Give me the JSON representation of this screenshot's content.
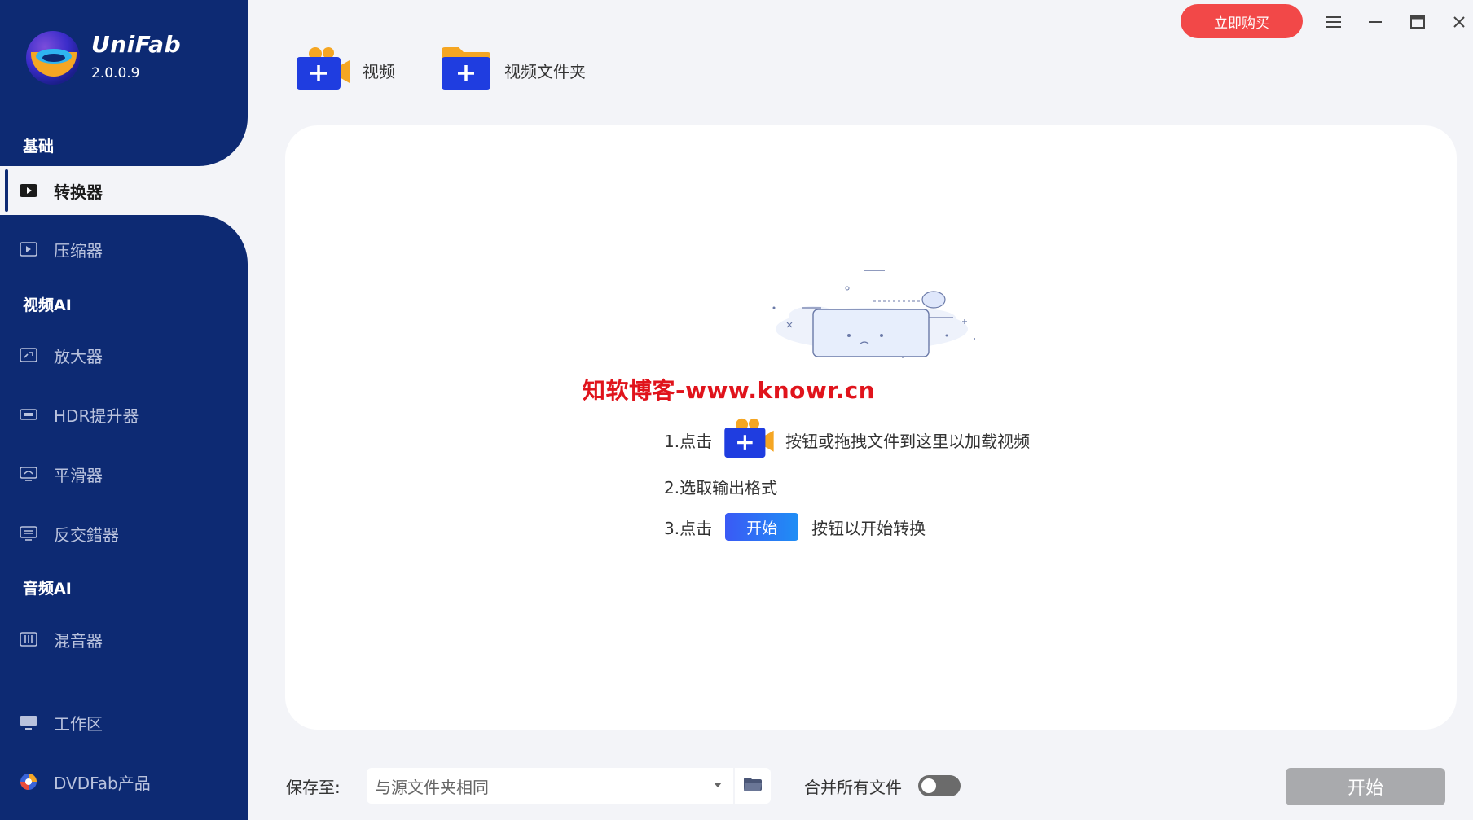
{
  "app": {
    "brand": "UniFab",
    "version": "2.0.0.9",
    "buy_label": "立即购买"
  },
  "sidebar": {
    "sections": {
      "basic": "基础",
      "video_ai": "视频AI",
      "audio_ai": "音频AI"
    },
    "items": [
      {
        "label": "转换器",
        "icon": "play-icon",
        "active": true
      },
      {
        "label": "压缩器",
        "icon": "compress-icon"
      },
      {
        "label": "放大器",
        "icon": "upscale-icon"
      },
      {
        "label": "HDR提升器",
        "icon": "hdr-icon"
      },
      {
        "label": "平滑器",
        "icon": "smoother-icon"
      },
      {
        "label": "反交錯器",
        "icon": "deinterlace-icon"
      },
      {
        "label": "混音器",
        "icon": "mixer-icon"
      },
      {
        "label": "工作区",
        "icon": "monitor-icon"
      },
      {
        "label": "DVDFab产品",
        "icon": "dvdfab-icon"
      }
    ]
  },
  "toolbar": {
    "add_video": "视频",
    "add_folder": "视频文件夹"
  },
  "main": {
    "watermark": "知软博客-www.knowr.cn",
    "steps": {
      "s1_prefix": "1.点击",
      "s1_suffix": "按钮或拖拽文件到这里以加载视频",
      "s2": "2.选取输出格式",
      "s3_prefix": "3.点击",
      "s3_chip": "开始",
      "s3_suffix": "按钮以开始转换"
    }
  },
  "bottom": {
    "save_label": "保存至:",
    "save_value": "与源文件夹相同",
    "merge_label": "合并所有文件",
    "merge_on": false,
    "start_label": "开始"
  },
  "colors": {
    "sidebar": "#0d2a73",
    "buy": "#f24848",
    "accent": "#1f5af5",
    "start_disabled": "#a9aaad"
  }
}
